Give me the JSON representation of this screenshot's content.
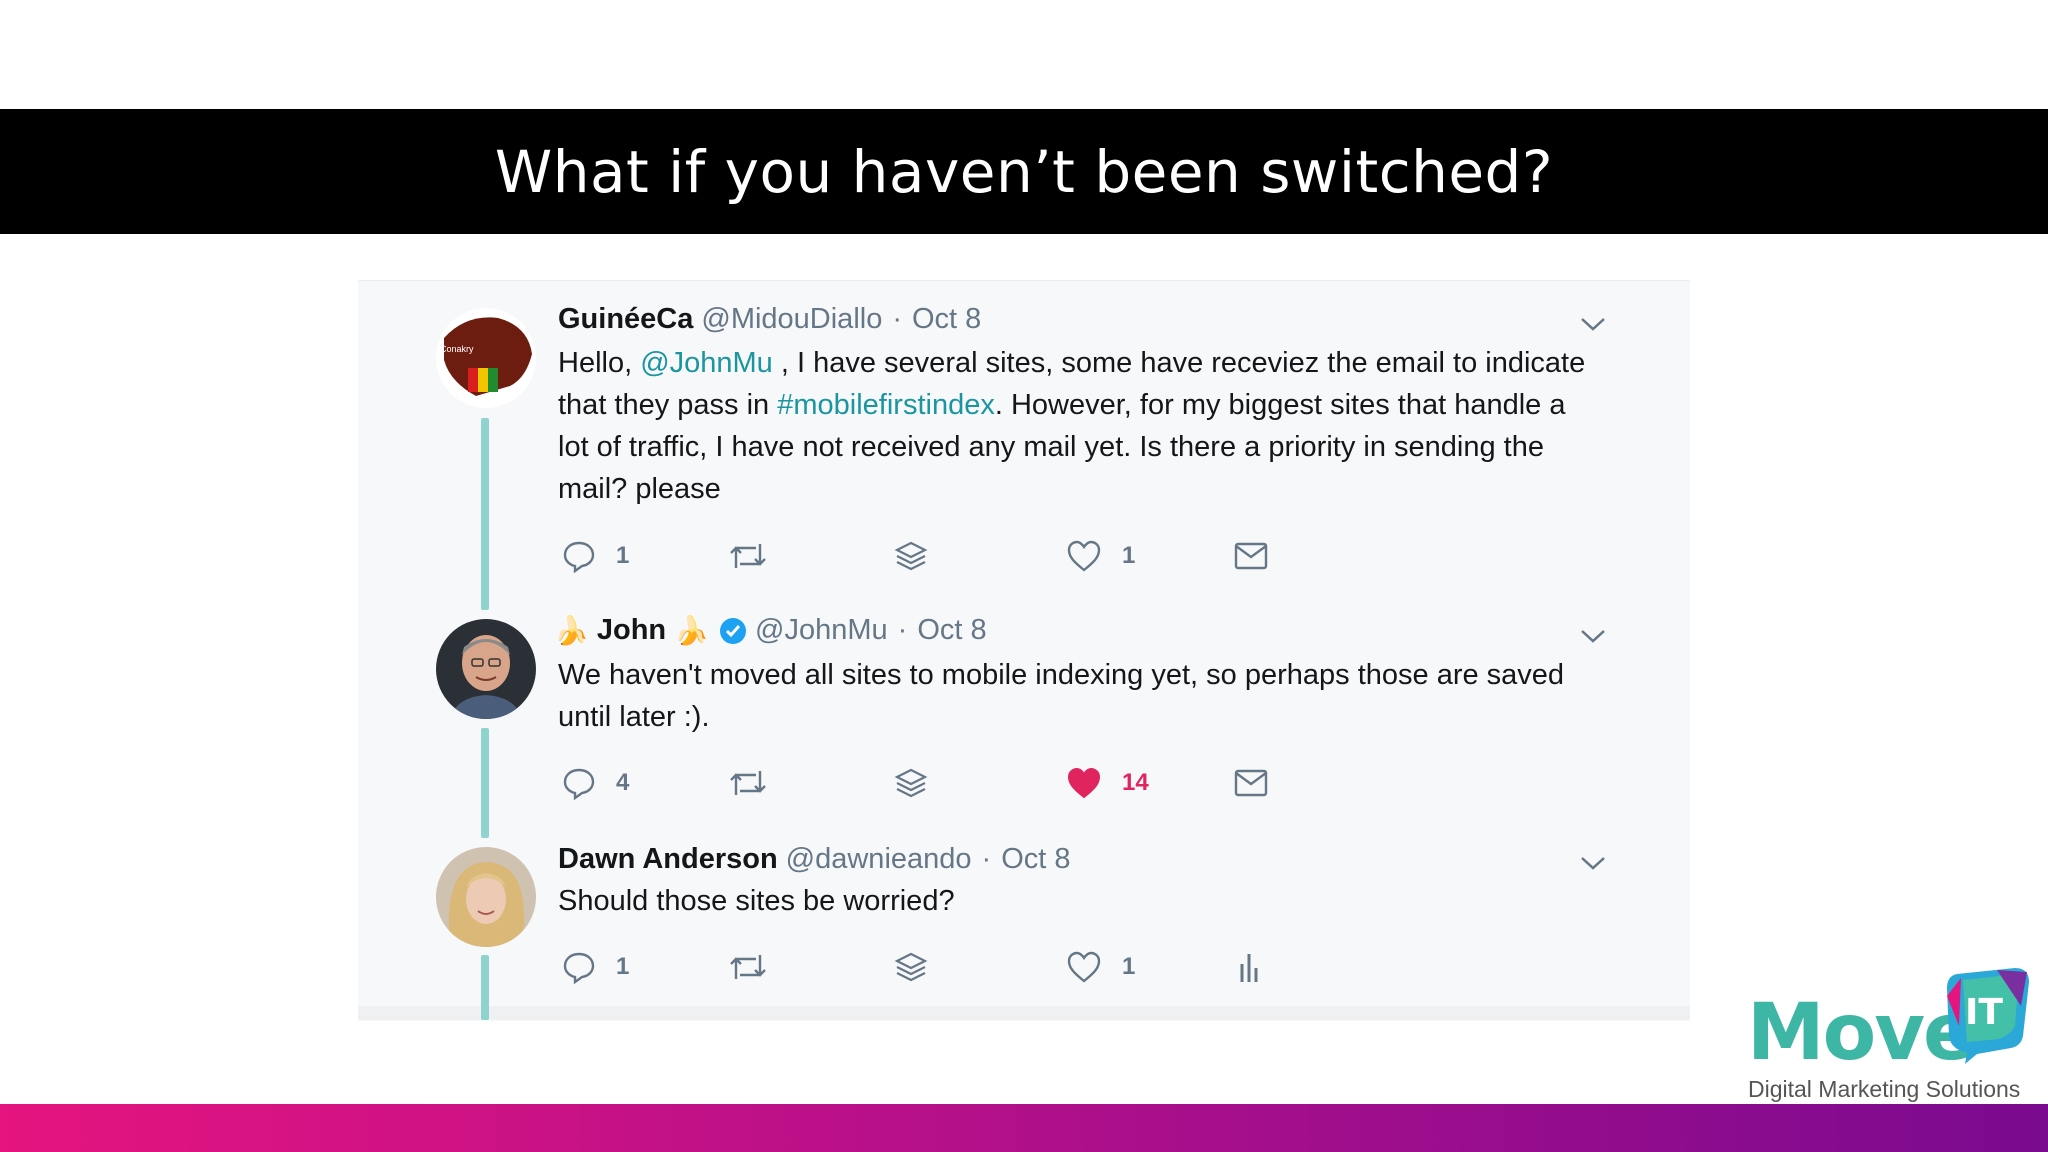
{
  "slide": {
    "title": "What if you haven’t been switched?"
  },
  "tweets": [
    {
      "name": "GuinéeCa",
      "handle": "@MidouDiallo",
      "sep": "·",
      "date": "Oct 8",
      "text": {
        "t1": "Hello, ",
        "l1": "@JohnMu",
        "t2": " , I have several sites, some have receviez the email to indicate that they pass in ",
        "l2": "#mobilefirstindex",
        "t3": ". However, for my biggest sites that handle a lot of traffic, I have not received any mail yet. Is there a priority in sending the mail? please"
      },
      "replies": "1",
      "likes": "1",
      "liked": false,
      "last_icon": "mail-icon"
    },
    {
      "name": "John",
      "name_emoji": "🍌",
      "verified": true,
      "handle": "@JohnMu",
      "sep": "·",
      "date": "Oct 8",
      "text": "We haven't moved all sites to mobile indexing yet, so perhaps those are saved until later :).",
      "replies": "4",
      "likes": "14",
      "liked": true,
      "like_color": "#e0245e",
      "last_icon": "mail-icon"
    },
    {
      "name": "Dawn Anderson",
      "handle": "@dawnieando",
      "sep": "·",
      "date": "Oct 8",
      "text": "Should those sites be worried?",
      "replies": "1",
      "likes": "1",
      "liked": false,
      "last_icon": "analytics-icon"
    }
  ],
  "logo": {
    "word": "Move",
    "badge": "IT",
    "tagline": "Digital Marketing Solutions"
  },
  "colors": {
    "thread_line": "#8fd3cf",
    "link": "#1b95a0",
    "logo_teal": "#3db6a6",
    "bar_start": "#e5147f",
    "bar_end": "#7a0a8f"
  }
}
